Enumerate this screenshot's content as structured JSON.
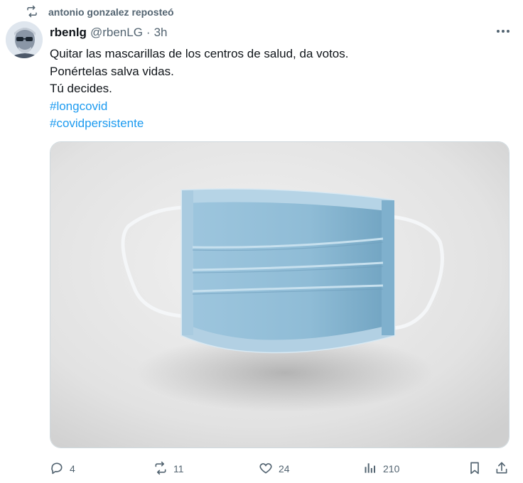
{
  "repost": {
    "icon": "repost-icon",
    "label": "antonio gonzalez reposteó"
  },
  "author": {
    "name": "rbenlg",
    "handle": "@rbenLG",
    "separator": "·",
    "time": "3h",
    "avatar_icon": "avatar"
  },
  "tweet": {
    "lines": [
      "Quitar las mascarillas de los centros de salud, da votos.",
      "Ponértelas salva vidas.",
      "Tú decides."
    ],
    "hashtags": [
      "#longcovid",
      "#covidpersistente"
    ]
  },
  "media": {
    "description_icon": "face-mask-photo"
  },
  "actions": {
    "replies": "4",
    "reposts": "11",
    "likes": "24",
    "views": "210"
  },
  "colors": {
    "accent": "#1d9bf0",
    "secondary_text": "#536471",
    "text": "#0f1419"
  }
}
